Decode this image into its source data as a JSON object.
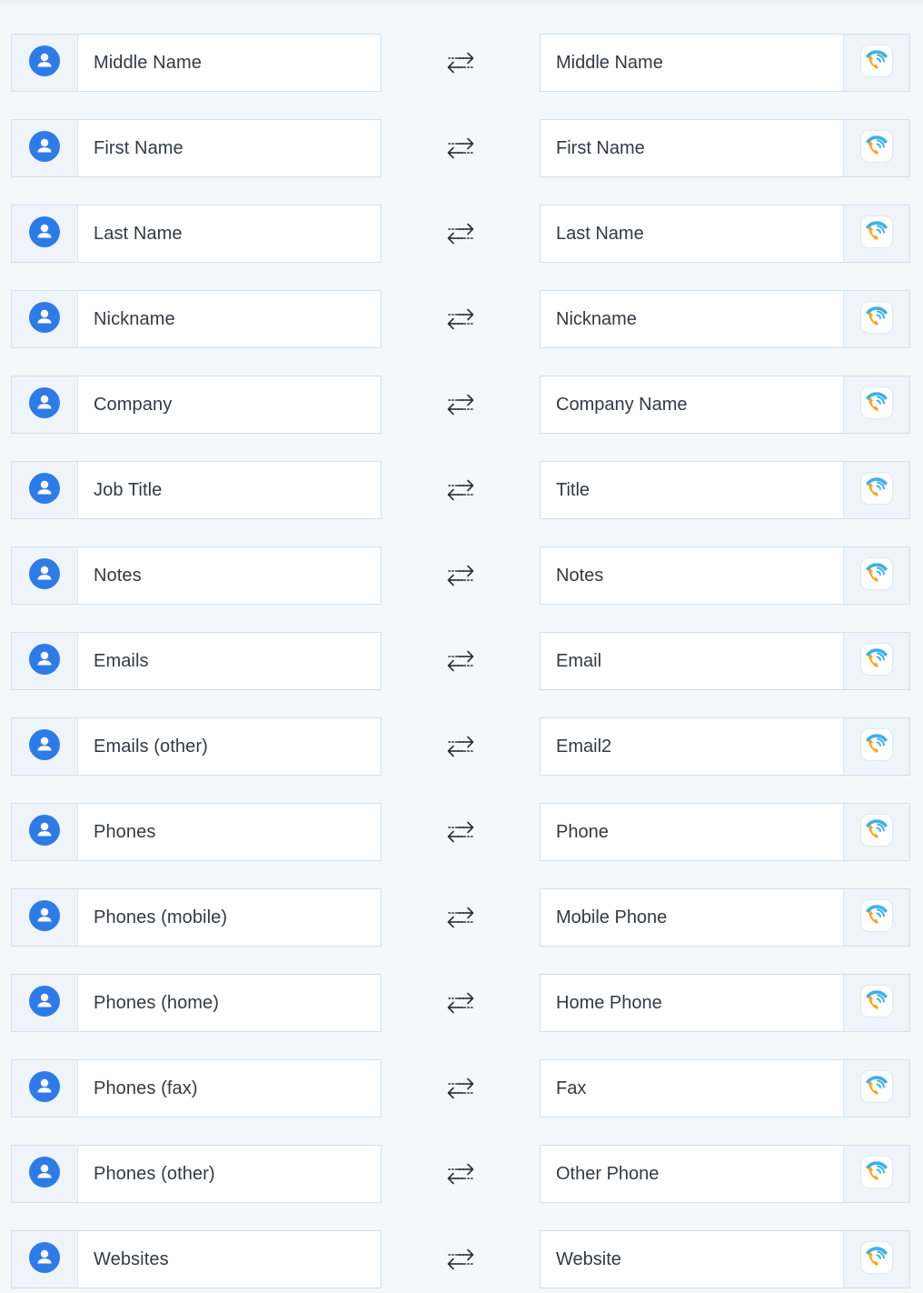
{
  "icons": {
    "left": "person-icon",
    "middle": "swap-arrows-icon",
    "right": "phone-app-icon"
  },
  "colors": {
    "accent": "#2f7be6",
    "app_blue": "#3fb0e8",
    "app_orange": "#f5a623",
    "border": "#cfe0ee",
    "background": "#f4f8fb"
  },
  "mappings": [
    {
      "left": "Middle Name",
      "right": "Middle Name"
    },
    {
      "left": "First Name",
      "right": "First Name"
    },
    {
      "left": "Last Name",
      "right": "Last Name"
    },
    {
      "left": "Nickname",
      "right": "Nickname"
    },
    {
      "left": "Company",
      "right": "Company Name"
    },
    {
      "left": "Job Title",
      "right": "Title"
    },
    {
      "left": "Notes",
      "right": "Notes"
    },
    {
      "left": "Emails",
      "right": "Email"
    },
    {
      "left": "Emails (other)",
      "right": "Email2"
    },
    {
      "left": "Phones",
      "right": "Phone"
    },
    {
      "left": "Phones (mobile)",
      "right": "Mobile Phone"
    },
    {
      "left": "Phones (home)",
      "right": "Home Phone"
    },
    {
      "left": "Phones (fax)",
      "right": "Fax"
    },
    {
      "left": "Phones (other)",
      "right": "Other Phone"
    },
    {
      "left": "Websites",
      "right": "Website"
    }
  ]
}
